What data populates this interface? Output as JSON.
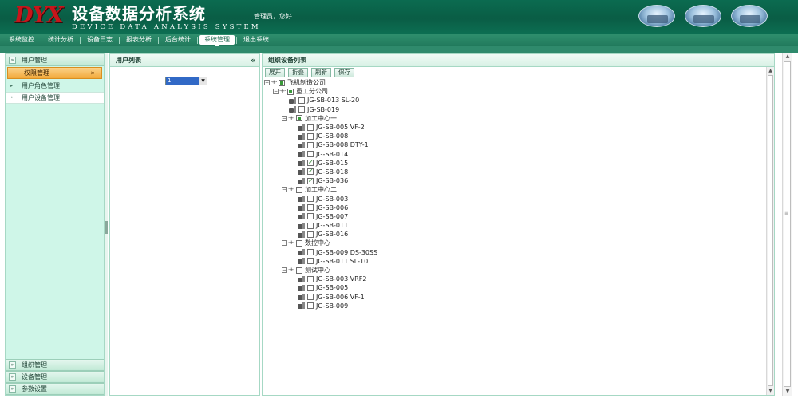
{
  "header": {
    "logo_mark": "DYX",
    "title": "设备数据分析系统",
    "subtitle": "DEVICE DATA ANALYSIS SYSTEM",
    "greeting": "管理员，您好"
  },
  "menu": {
    "items": [
      "系统监控",
      "统计分析",
      "设备日志",
      "报表分析",
      "后台统计",
      "系统管理",
      "退出系统"
    ],
    "active": "系统管理"
  },
  "sidebar": {
    "user_mgmt": "用户管理",
    "perm_mgmt": "权限管理",
    "perm_icon": "»",
    "sub_items": [
      "用户角色管理",
      "用户设备管理"
    ],
    "org_mgmt": "组织管理",
    "device_mgmt": "设备管理",
    "param_settings": "参数设置"
  },
  "user_panel": {
    "title": "用户列表",
    "collapse_icon": "«",
    "select_value": "1"
  },
  "device_panel": {
    "title": "组织设备列表",
    "toolbar": {
      "expand": "展开",
      "collapse": "折叠",
      "refresh": "刷新",
      "save": "保存"
    },
    "tree": {
      "root": "飞机制造公司",
      "branch": "重工分公司",
      "loose_devices": [
        "JG-SB-013 SL-20",
        "JG-SB-019"
      ],
      "group1": "加工中心一",
      "group1_devices": [
        "JG-SB-005 VF-2",
        "JG-SB-008",
        "JG-SB-008 DTY-1",
        "JG-SB-014",
        "JG-SB-015",
        "JG-SB-018",
        "JG-SB-036"
      ],
      "group2": "加工中心二",
      "group2_devices": [
        "JG-SB-003",
        "JG-SB-006",
        "JG-SB-007",
        "JG-SB-011",
        "JG-SB-016"
      ],
      "group3": "数控中心",
      "group3_devices": [
        "JG-SB-009 DS-30SS",
        "JG-SB-011 SL-10"
      ],
      "group4": "测试中心",
      "group4_devices": [
        "JG-SB-003 VRF2",
        "JG-SB-005",
        "JG-SB-006 VF-1",
        "JG-SB-009"
      ]
    }
  },
  "colors": {
    "header_green": "#0b6b50",
    "menubar_green": "#217a5c",
    "sidebar_bg": "#cff6e8",
    "perm_orange": "#f2a93a",
    "logo_red": "#c8151b"
  }
}
